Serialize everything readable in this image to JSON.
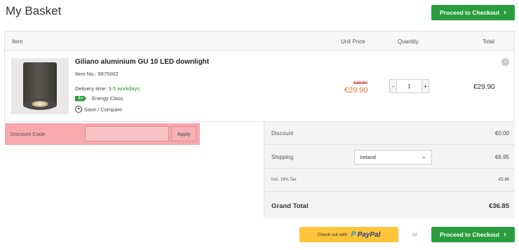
{
  "page_title": "My Basket",
  "checkout_button_label": "Proceed to Checkout",
  "table_headers": {
    "item": "Item",
    "unit_price": "Unit Price",
    "quantity": "Quantity",
    "total": "Total"
  },
  "product": {
    "name": "Giliano aluminium GU 10 LED downlight",
    "item_no": "Item No.: 9975002",
    "delivery_label": "Delivery time: ",
    "delivery_value": "3-5 workdays",
    "energy_badge": "A+",
    "energy_label": "Energy Class",
    "save_label": "Save / Compare",
    "old_price": "€39.90",
    "price": "€29.90",
    "quantity": "1",
    "qty_minus": "-",
    "qty_plus": "+",
    "line_total": "€29.90"
  },
  "discount": {
    "label": "Discount Code",
    "input_value": "",
    "input_placeholder": "",
    "apply_label": "Apply"
  },
  "summary": {
    "discount_label": "Discount",
    "discount_value": "€0.00",
    "shipping_label": "Shipping",
    "shipping_country": "Ireland",
    "shipping_value": "€6.95",
    "tax_label": "Incl. 19% Tax",
    "tax_value": "€5.88",
    "grand_total_label": "Grand Total",
    "grand_total_value": "€36.85"
  },
  "paypal": {
    "prefix": "Check out with",
    "brand": "PayPal"
  },
  "or_text": "or",
  "colors": {
    "accent_green": "#2a9d3e",
    "price_orange": "#e8772e",
    "discount_highlight": "#f7a9ad",
    "paypal_yellow": "#ffc43a"
  },
  "icons": {
    "chevron": "chevron-right-icon",
    "remove": "remove-icon",
    "save": "heart-icon",
    "select": "chevron-down-icon"
  }
}
